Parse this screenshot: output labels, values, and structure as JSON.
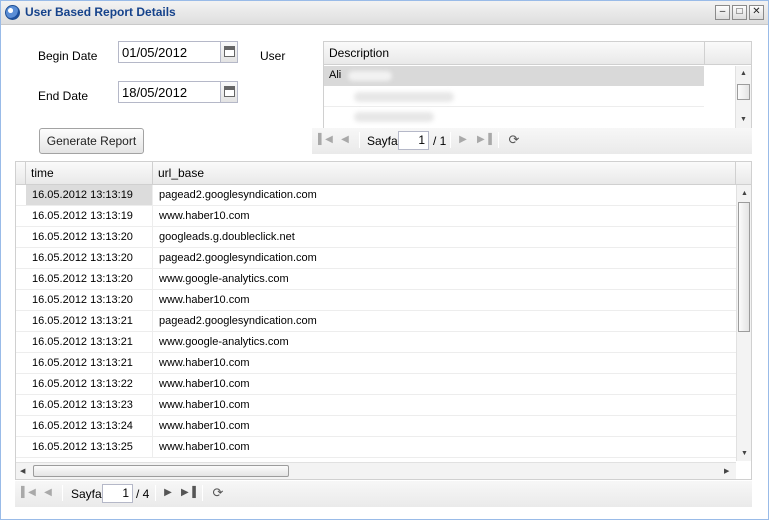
{
  "window": {
    "title": "User Based Report Details",
    "icon": "app-globe-icon",
    "controls": [
      "minimize-icon",
      "maximize-icon",
      "close-icon"
    ]
  },
  "form": {
    "begin_label": "Begin Date",
    "begin_value": "01/05/2012",
    "end_label": "End Date",
    "end_value": "18/05/2012",
    "user_label": "User",
    "generate_label": "Generate Report"
  },
  "user_grid": {
    "header": "Description",
    "rows": [
      "Ali"
    ],
    "pager": {
      "page_label": "Sayfa",
      "page": "1",
      "total": "/ 1"
    }
  },
  "report_grid": {
    "headers": [
      "time",
      "url_base"
    ],
    "rows": [
      [
        "16.05.2012 13:13:19",
        "pagead2.googlesyndication.com"
      ],
      [
        "16.05.2012 13:13:19",
        "www.haber10.com"
      ],
      [
        "16.05.2012 13:13:20",
        "googleads.g.doubleclick.net"
      ],
      [
        "16.05.2012 13:13:20",
        "pagead2.googlesyndication.com"
      ],
      [
        "16.05.2012 13:13:20",
        "www.google-analytics.com"
      ],
      [
        "16.05.2012 13:13:20",
        "www.haber10.com"
      ],
      [
        "16.05.2012 13:13:21",
        "pagead2.googlesyndication.com"
      ],
      [
        "16.05.2012 13:13:21",
        "www.google-analytics.com"
      ],
      [
        "16.05.2012 13:13:21",
        "www.haber10.com"
      ],
      [
        "16.05.2012 13:13:22",
        "www.haber10.com"
      ],
      [
        "16.05.2012 13:13:23",
        "www.haber10.com"
      ],
      [
        "16.05.2012 13:13:24",
        "www.haber10.com"
      ],
      [
        "16.05.2012 13:13:25",
        "www.haber10.com"
      ]
    ],
    "pager": {
      "page_label": "Sayfa",
      "page": "1",
      "total": "/ 4"
    }
  }
}
